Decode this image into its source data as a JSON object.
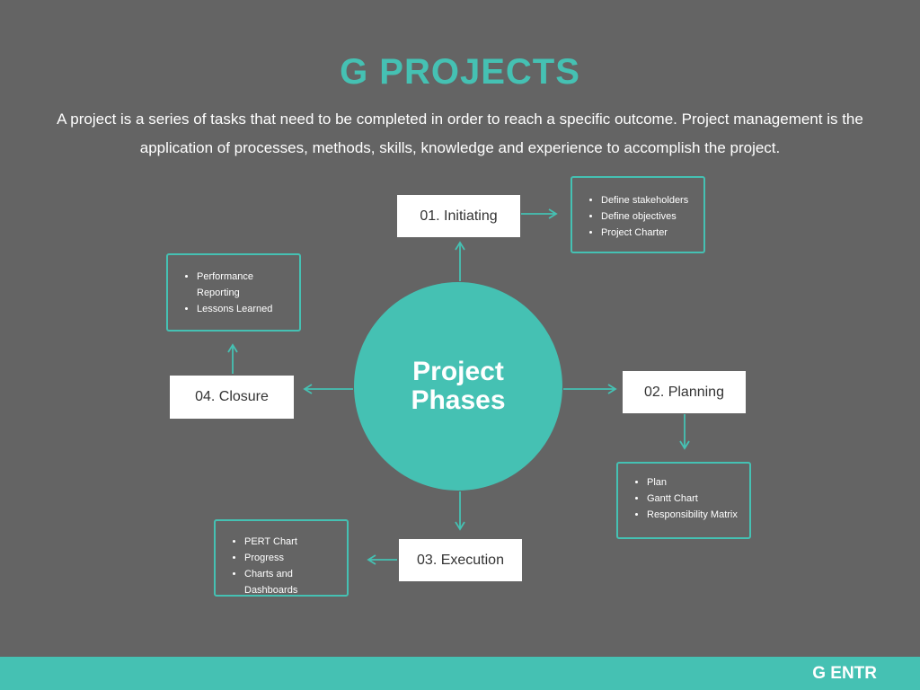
{
  "header": {
    "title": "G PROJECTS",
    "description": "A project is a series of tasks that need to be completed in order to reach a specific outcome.  Project management is the application of processes, methods, skills, knowledge and experience to accomplish the project."
  },
  "center": {
    "label": "Project Phases"
  },
  "phases": [
    {
      "label": "01. Initiating",
      "items": [
        "Define stakeholders",
        "Define objectives",
        "Project Charter"
      ]
    },
    {
      "label": "02. Planning",
      "items": [
        "Plan",
        "Gantt Chart",
        "Responsibility Matrix"
      ]
    },
    {
      "label": "03. Execution",
      "items": [
        "PERT Chart",
        "Progress",
        "Charts and Dashboards"
      ]
    },
    {
      "label": "04. Closure",
      "items": [
        "Performance Reporting",
        "Lessons Learned"
      ]
    }
  ],
  "footer": {
    "brand": "G ENTR"
  },
  "colors": {
    "accent": "#45c1b3",
    "background": "#646464",
    "box": "#ffffff"
  }
}
